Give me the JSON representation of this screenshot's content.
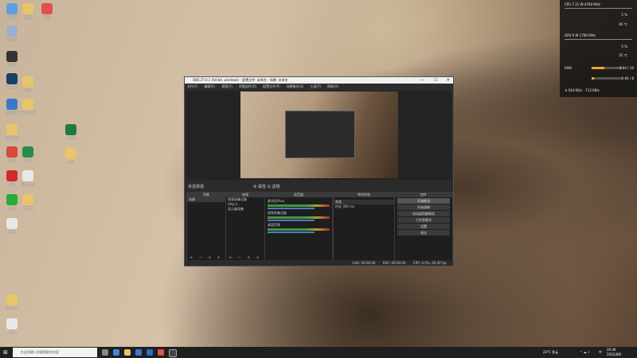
{
  "desktop": {
    "icons": [
      {
        "label": "此电脑",
        "color": "#5aa0e0"
      },
      {
        "label": "文件",
        "color": "#e8c46a"
      },
      {
        "label": "软件",
        "color": "#e05050"
      },
      {
        "label": "回收站",
        "color": "#9ab0c8"
      },
      {
        "label": "网易云",
        "color": "#333333"
      },
      {
        "label": "Steam",
        "color": "#1b3d6a"
      },
      {
        "label": "文档",
        "color": "#e8c46a"
      },
      {
        "label": "控制面板",
        "color": "#3a78d0"
      },
      {
        "label": "新建文件夹",
        "color": "#e8c46a"
      },
      {
        "label": "Excel",
        "color": "#1e7a3e"
      },
      {
        "label": "新建文件",
        "color": "#e8c46a"
      },
      {
        "label": "小说",
        "color": "#e8c46a"
      },
      {
        "label": "谷歌",
        "color": "#d84a3a"
      },
      {
        "label": "表格",
        "color": "#2a8a4a"
      },
      {
        "label": "网易",
        "color": "#d02a2a"
      },
      {
        "label": "日常文件",
        "color": "#e8e8e8"
      },
      {
        "label": "微信",
        "color": "#2aaa3a"
      },
      {
        "label": "文件夹",
        "color": "#e8c46a"
      },
      {
        "label": "设置",
        "color": "#e8e8e8"
      },
      {
        "label": "新建文本",
        "color": "#e8c46a"
      },
      {
        "label": "文本",
        "color": "#e8e8e8"
      }
    ]
  },
  "obs": {
    "title": "OBS 27.0.1 (64-bit, windows) - 配置文件: 未命名 - 场景: 未命名",
    "menu": [
      "文件(F)",
      "编辑(E)",
      "视图(V)",
      "停靠部件(D)",
      "配置文件(P)",
      "场景集合(S)",
      "工具(T)",
      "帮助(H)"
    ],
    "scene_label": "未选择源",
    "scene_ctrls": "⚙ 属性  ⊟ 滤镜",
    "panels": {
      "scenes": {
        "title": "场景",
        "items": [
          "场景"
        ]
      },
      "sources": {
        "title": "来源",
        "items": [
          "视频采集设备",
          "http://...",
          "显示器采集"
        ]
      },
      "mixer": {
        "title": "混音器",
        "items": [
          "麦克风/Aux",
          "视频采集设备",
          "桌面音频"
        ]
      },
      "transitions": {
        "title": "转场特效",
        "type": "渐变",
        "duration_label": "时长",
        "duration": "300 ms"
      },
      "controls": {
        "title": "控件",
        "buttons": [
          "开始推流",
          "开始录制",
          "启动虚拟摄像机",
          "工作室模式",
          "设置",
          "退出"
        ]
      }
    },
    "footer_icons": "+ − ∧ ∨",
    "status": {
      "live": "LIVE: 00:00:00",
      "rec": "REC: 00:00:00",
      "cpu": "CPU: 0.0%, 60.00 fps"
    }
  },
  "hwmonitor": {
    "cpu_label": "CPU",
    "cpu_info": "7.21 W  4700 MHz",
    "cpu_pct": "5 %",
    "cpu_temp": "46 ℃",
    "gpu_label": "GPU",
    "gpu_info": "9 W  1780 MHz",
    "gpu_pct": "5 %",
    "gpu_temp": "35 ℃",
    "ram_label": "RAM",
    "ram_val": "6.80 / 16",
    "vram_val": "0.66 / 8",
    "net_down": "544 KB/s",
    "net_up": "713 KB/s",
    "ram_fraction": 0.43,
    "vram_fraction": 0.08
  },
  "taskbar": {
    "search_placeholder": "在这里输入你要搜索的内容",
    "weather": "23°C 多云",
    "lang": "中",
    "time": "20:46",
    "date": "2021/8/8"
  }
}
